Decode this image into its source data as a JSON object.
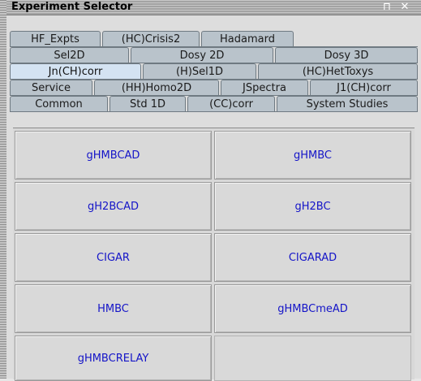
{
  "window": {
    "title": "Experiment Selector",
    "pin_glyph": "⊓",
    "close_glyph": "✕"
  },
  "tabs": {
    "rows": [
      [
        "HF_Expts",
        "(HC)Crisis2",
        "Hadamard"
      ],
      [
        "Sel2D",
        "Dosy 2D",
        "Dosy 3D"
      ],
      [
        "Jn(CH)corr",
        "(H)Sel1D",
        "(HC)HetToxys"
      ],
      [
        "Service",
        "(HH)Homo2D",
        "JSpectra",
        "J1(CH)corr"
      ],
      [
        "Common",
        "Std 1D",
        "(CC)corr",
        "System Studies"
      ]
    ],
    "active": "Jn(CH)corr"
  },
  "experiments": [
    "gHMBCAD",
    "gHMBC",
    "gH2BCAD",
    "gH2BC",
    "CIGAR",
    "CIGARAD",
    "HMBC",
    "gHMBCmeAD",
    "gHMBCRELAY"
  ],
  "colors": {
    "tab_bg": "#b9c3cb",
    "tab_active_bg": "#d4e3f2",
    "button_text": "#1414c8"
  }
}
